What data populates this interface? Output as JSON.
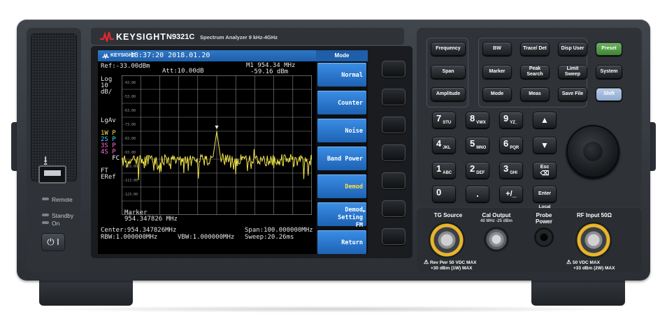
{
  "brand": {
    "name": "KEYSIGHT",
    "model": "N9321C",
    "description": "Spectrum Analyzer 9 kHz-4GHz"
  },
  "left_panel": {
    "usb_icon": "usb-icon",
    "leds": [
      "Remote",
      "Standby",
      "On"
    ],
    "power_icon": "power-icon"
  },
  "screen": {
    "brand": "KEYSIGHT",
    "datetime": "18:37:20 2018.01.20",
    "ref_level": "Ref:-33.00dBm",
    "attenuation": "Att:10.00dB",
    "scale_lines": [
      "Log",
      "10",
      "dB/"
    ],
    "marker_readout": {
      "freq": "M1 954.34 MHz",
      "level": "-59.16 dBm"
    },
    "trace_lines": [
      "LgAv",
      "",
      "1W P",
      "2S P",
      "3S P",
      "4S P",
      "   FC",
      "",
      "FT",
      "ERef"
    ],
    "trace_colors": [
      "#ffffff",
      "#ffffff",
      "#ffe24a",
      "#47d3ff",
      "#ff6fd8",
      "#ff6fd8",
      "#ffffff"
    ],
    "ytick_labels": [
      "-43.00",
      "-53.00",
      "-63.00",
      "-73.00",
      "-83.00",
      "-93.00",
      "-103.00",
      "-113.00",
      "-123.00"
    ],
    "marker_label": "Marker",
    "marker_value": "954.347826 MHz",
    "center": "Center:954.347826MHz",
    "span": "Span:100.000000MHz",
    "rbw": "RBW:1.000000MHz",
    "vbw": "VBW:1.000000MHz",
    "sweep": "Sweep:20.26ms",
    "trace_color": "#f2e64a",
    "menu_title": "Mode",
    "softkeys": [
      {
        "label": "Normal",
        "sub": ""
      },
      {
        "label": "Counter",
        "sub": ""
      },
      {
        "label": "Noise",
        "sub": ""
      },
      {
        "label": "Band Power",
        "sub": ""
      },
      {
        "label": "Demod",
        "sub": ""
      },
      {
        "label": "Demod Setting",
        "sub": "FM"
      },
      {
        "label": "Return",
        "sub": ""
      }
    ]
  },
  "keys": {
    "frequency": "Frequency",
    "span": "Span",
    "amplitude": "Amplitude",
    "bw": "BW",
    "trace_det": "Trace/ Det",
    "disp_user": "Disp User",
    "marker": "Marker",
    "peak_search": "Peak Search",
    "limit_sweep": "Limit Sweep",
    "mode": "Mode",
    "meas": "Meas",
    "save_file": "Save File",
    "preset": "Preset",
    "system": "System",
    "shift": "Shift",
    "enter": "Enter",
    "local": "Local",
    "numpad": [
      {
        "n": "7",
        "s": "STU"
      },
      {
        "n": "8",
        "s": "VWX"
      },
      {
        "n": "9",
        "s": "YZ_"
      },
      {
        "n": "4",
        "s": "JKL"
      },
      {
        "n": "5",
        "s": "MNO"
      },
      {
        "n": "6",
        "s": "PQR"
      },
      {
        "n": "1",
        "s": "ABC"
      },
      {
        "n": "2",
        "s": "DEF"
      },
      {
        "n": "3",
        "s": "GHI"
      },
      {
        "n": "0",
        "s": ""
      },
      {
        "n": ".",
        "s": ""
      },
      {
        "n": "+/_",
        "s": ""
      }
    ],
    "esc": "Esc"
  },
  "connectors": {
    "tg_source": "TG Source",
    "tg_warning": [
      "Rev Pwr 50 VDC MAX",
      "+30 dBm (1W) MAX"
    ],
    "cal_output": "Cal Output",
    "cal_sub": "40 MHz -25 dBm",
    "probe_power": "Probe Power",
    "rf_input": "RF Input 50Ω",
    "rf_warning": [
      "50 VDC MAX",
      "+33 dBm (2W) MAX"
    ]
  },
  "colors": {
    "accent_green": "#4f9b44",
    "shift_blue": "#9db7da",
    "connector_gold": "#e8b52c",
    "softkey_blue": "#2a7ad4"
  }
}
